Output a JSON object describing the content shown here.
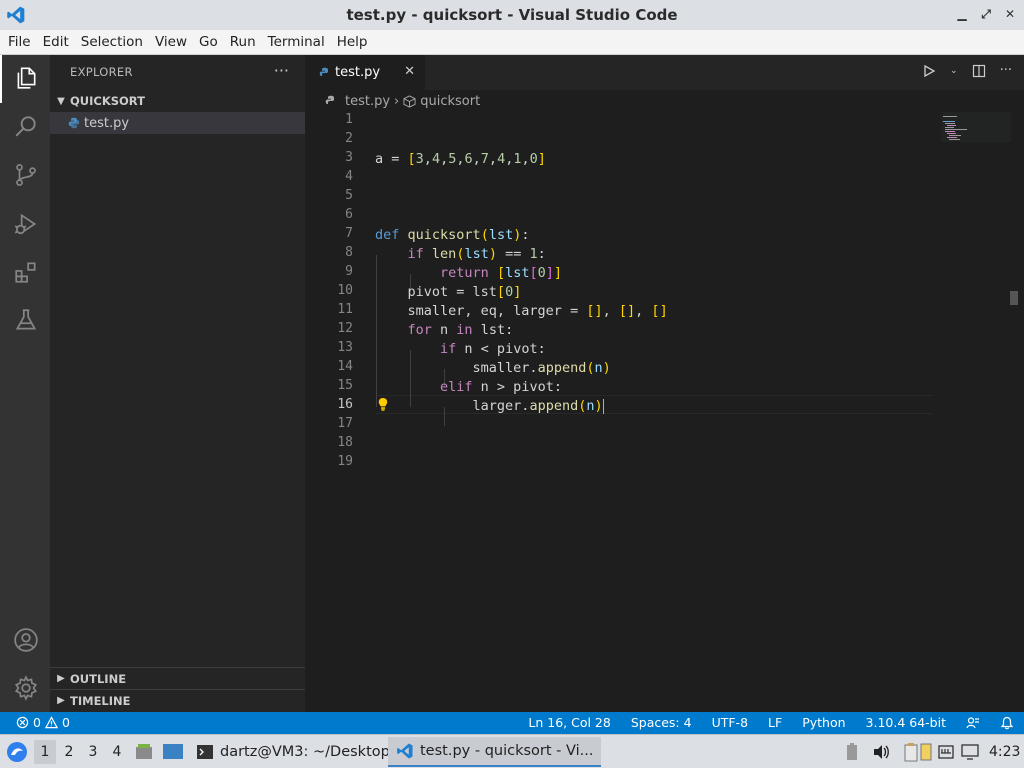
{
  "window": {
    "title": "test.py - quicksort - Visual Studio Code"
  },
  "menu": [
    "File",
    "Edit",
    "Selection",
    "View",
    "Go",
    "Run",
    "Terminal",
    "Help"
  ],
  "sidebar": {
    "header": "EXPLORER",
    "more": "···",
    "folder": "QUICKSORT",
    "file": "test.py",
    "outline": "OUTLINE",
    "timeline": "TIMELINE"
  },
  "editor": {
    "tab_label": "test.py",
    "tab_close": "✕",
    "breadcrumb_file": "test.py",
    "breadcrumb_symbol": "quicksort",
    "line_numbers": [
      "1",
      "2",
      "3",
      "4",
      "5",
      "6",
      "7",
      "8",
      "9",
      "10",
      "11",
      "12",
      "13",
      "14",
      "15",
      "16",
      "17",
      "18",
      "19"
    ],
    "current_line": "16"
  },
  "code_lines": [
    "",
    "",
    "a = [3,4,5,6,7,4,1,0]",
    "",
    "",
    "",
    "def quicksort(lst):",
    "    if len(lst) == 1:",
    "        return [lst[0]]",
    "    pivot = lst[0]",
    "    smaller, eq, larger = [], [], []",
    "    for n in lst:",
    "        if n < pivot:",
    "            smaller.append(n)",
    "        elif n > pivot:",
    "            larger.append(n)",
    "",
    "",
    ""
  ],
  "status": {
    "errors": "0",
    "warnings": "0",
    "position": "Ln 16, Col 28",
    "spaces": "Spaces: 4",
    "encoding": "UTF-8",
    "eol": "LF",
    "language": "Python",
    "interpreter": "3.10.4 64-bit"
  },
  "taskbar": {
    "workspaces": [
      "1",
      "2",
      "3",
      "4"
    ],
    "terminal_task": "dartz@VM3: ~/Desktop",
    "vscode_task": "test.py - quicksort - Vi...",
    "clock": "4:23"
  },
  "colors": {
    "accent": "#007acc",
    "editor_bg": "#1e1e1e",
    "sidebar_bg": "#252526",
    "activity_bg": "#333333"
  }
}
